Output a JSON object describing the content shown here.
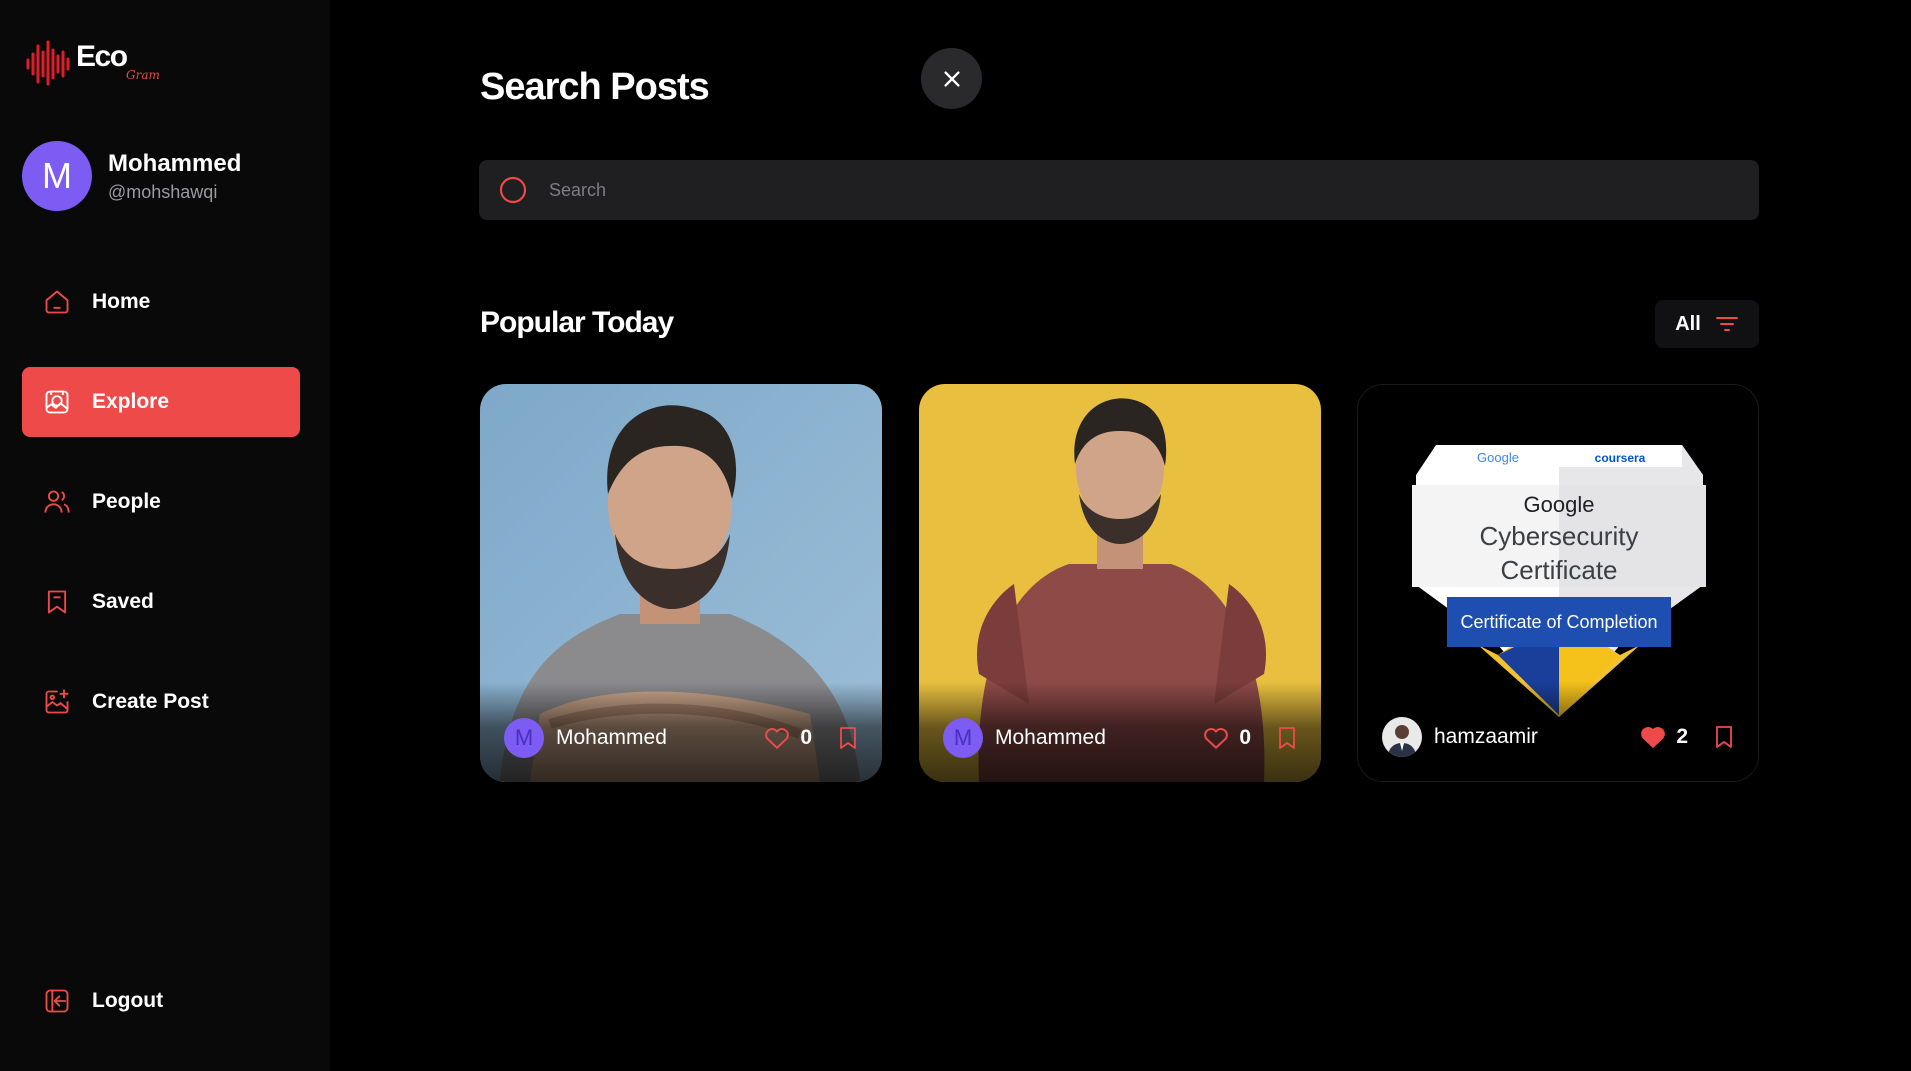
{
  "app": {
    "logo_text": "Eco",
    "logo_sub": "Gram"
  },
  "user": {
    "initial": "M",
    "name": "Mohammed",
    "handle": "@mohshawqi"
  },
  "nav": {
    "items": [
      {
        "label": "Home",
        "icon": "home-icon"
      },
      {
        "label": "Explore",
        "icon": "explore-icon",
        "active": true
      },
      {
        "label": "People",
        "icon": "people-icon"
      },
      {
        "label": "Saved",
        "icon": "bookmark-icon"
      },
      {
        "label": "Create Post",
        "icon": "create-post-icon"
      }
    ],
    "logout": "Logout"
  },
  "page": {
    "title": "Search Posts",
    "search_placeholder": "Search",
    "section_title": "Popular Today",
    "filter_label": "All"
  },
  "posts": [
    {
      "author": "Mohammed",
      "avatar_initial": "M",
      "likes": "0",
      "liked": false,
      "image": "man-blue-background"
    },
    {
      "author": "Mohammed",
      "avatar_initial": "M",
      "likes": "0",
      "liked": false,
      "image": "man-yellow-background"
    },
    {
      "author": "hamzaamir",
      "avatar_initial": "",
      "likes": "2",
      "liked": true,
      "image": "certificate-badge",
      "certificate": {
        "brand_left": "Google",
        "brand_right": "coursera",
        "line1": "Google",
        "line2": "Cybersecurity",
        "line3": "Certificate",
        "ribbon": "Certificate of Completion"
      }
    }
  ],
  "colors": {
    "accent": "#ef4a4a",
    "avatar": "#7c5cf3",
    "sidebar": "#09090a",
    "input": "#1f1f22"
  }
}
